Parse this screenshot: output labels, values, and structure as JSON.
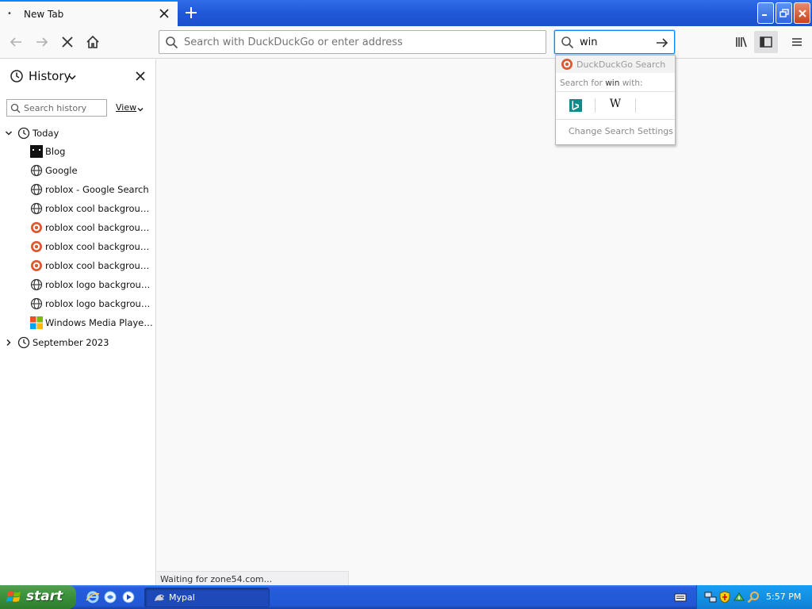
{
  "tab": {
    "title": "New Tab",
    "dot": "•"
  },
  "nav": {
    "url_placeholder": "Search with DuckDuckGo or enter address",
    "search_value": "win"
  },
  "sidebar": {
    "title": "History",
    "search_placeholder": "Search history",
    "view_label": "View",
    "groups": [
      {
        "label": "Today",
        "expanded": true
      },
      {
        "label": "September 2023",
        "expanded": false
      }
    ],
    "items": [
      {
        "label": "Blog",
        "icon": "blog-favicon"
      },
      {
        "label": "Google",
        "icon": "globe-icon"
      },
      {
        "label": "roblox - Google Search",
        "icon": "globe-icon"
      },
      {
        "label": "roblox cool background - ...",
        "icon": "globe-icon"
      },
      {
        "label": "roblox cool background at ...",
        "icon": "duckduckgo-icon"
      },
      {
        "label": "roblox cool background at ...",
        "icon": "duckduckgo-icon"
      },
      {
        "label": "roblox cool background at ...",
        "icon": "duckduckgo-icon"
      },
      {
        "label": "roblox logo background - ...",
        "icon": "globe-icon"
      },
      {
        "label": "roblox logo background - ...",
        "icon": "globe-icon"
      },
      {
        "label": "Windows Media Player err...",
        "icon": "windows-icon"
      }
    ]
  },
  "popup": {
    "engine_label": "DuckDuckGo Search",
    "search_for_prefix": "Search for",
    "search_for_term": "win",
    "search_for_suffix": "with:",
    "wiki_glyph": "W",
    "settings_label": "Change Search Settings"
  },
  "status": {
    "text": "Waiting for zone54.com..."
  },
  "taskbar": {
    "start_label": "start",
    "task_label": "Mypal",
    "time": "5:57 PM"
  },
  "colors": {
    "accent": "#0a84ff",
    "xp_blue": "#245edb",
    "start_green": "#3a8f3a",
    "tray_blue": "#1391e4"
  }
}
